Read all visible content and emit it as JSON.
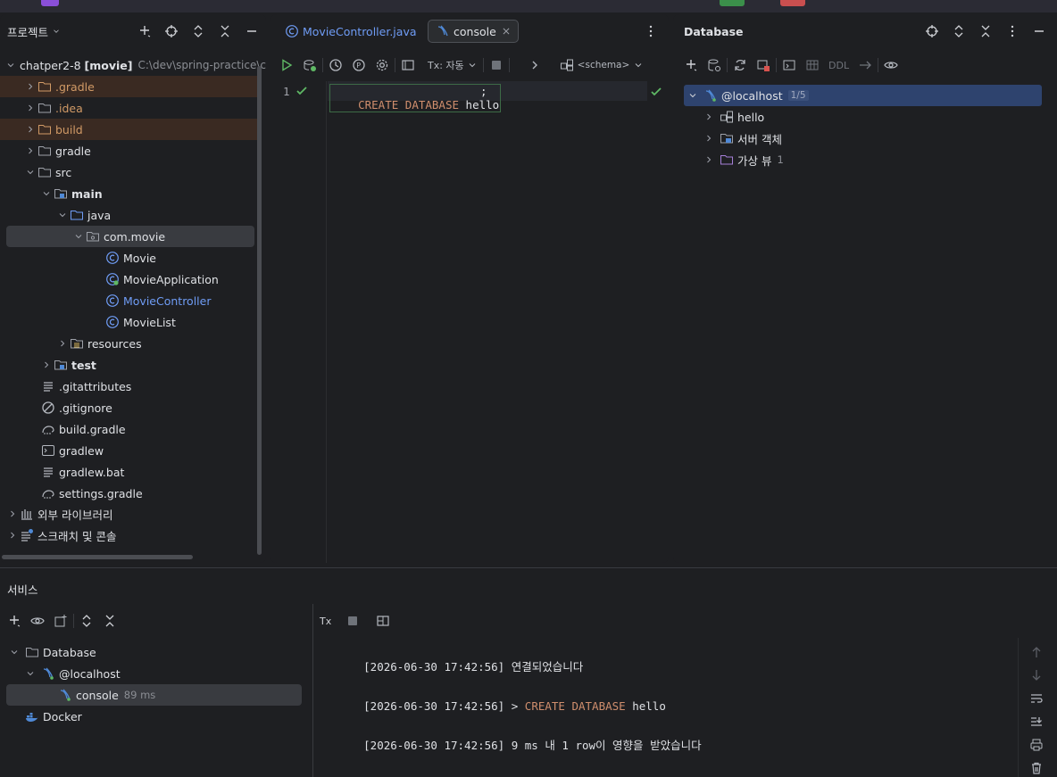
{
  "project": {
    "title": "프로젝트",
    "root": {
      "name": "chatper2-8",
      "module": "[movie]",
      "path": "C:\\dev\\spring-practice\\c"
    },
    "items": [
      {
        "label": ".gradle"
      },
      {
        "label": ".idea"
      },
      {
        "label": "build"
      },
      {
        "label": "gradle"
      },
      {
        "label": "src"
      },
      {
        "label": "main"
      },
      {
        "label": "java"
      },
      {
        "label": "com.movie"
      },
      {
        "label": "Movie"
      },
      {
        "label": "MovieApplication"
      },
      {
        "label": "MovieController"
      },
      {
        "label": "MovieList"
      },
      {
        "label": "resources"
      },
      {
        "label": "test"
      },
      {
        "label": ".gitattributes"
      },
      {
        "label": ".gitignore"
      },
      {
        "label": "build.gradle"
      },
      {
        "label": "gradlew"
      },
      {
        "label": "gradlew.bat"
      },
      {
        "label": "settings.gradle"
      },
      {
        "label": "외부 라이브러리"
      },
      {
        "label": "스크래치 및 콘솔"
      }
    ]
  },
  "editor": {
    "tabs": [
      {
        "label": "MovieController.java"
      },
      {
        "label": "console"
      }
    ],
    "toolbar": {
      "tx_label": "Tx: 자동",
      "schema_label": "<schema>"
    },
    "line_number": "1",
    "code": {
      "kw1": "CREATE",
      "kw2": "DATABASE",
      "ident": "hello",
      "semi": ";"
    }
  },
  "database": {
    "title": "Database",
    "ddl_label": "DDL",
    "host": {
      "label": "@localhost",
      "badge": "1/5"
    },
    "items": [
      {
        "label": "hello"
      },
      {
        "label": "서버 객체"
      },
      {
        "label": "가상 뷰",
        "count": "1"
      }
    ]
  },
  "services": {
    "title": "서비스",
    "tx_label": "Tx",
    "tree": {
      "database": "Database",
      "host": "@localhost",
      "console": "console",
      "console_time": "89 ms",
      "docker": "Docker"
    },
    "log": [
      {
        "ts": "[2026-06-30 17:42:56]",
        "pre": "연결되었습니다",
        "kw": "",
        "rest": ""
      },
      {
        "ts": "[2026-06-30 17:42:56]",
        "pre": ">",
        "kw": "CREATE DATABASE",
        "rest": "hello"
      },
      {
        "ts": "[2026-06-30 17:42:56]",
        "pre": "9 ms 내 1 row이 영향을 받았습니다",
        "kw": "",
        "rest": ""
      }
    ]
  },
  "colors": {
    "accent": "#3574f0",
    "selection": "#2e436e",
    "keyword": "#cf8e6d",
    "success": "#5fb865",
    "excluded_bg": "#3a2a22",
    "excluded_text": "#d19a66",
    "link_blue": "#6f9cf5"
  }
}
